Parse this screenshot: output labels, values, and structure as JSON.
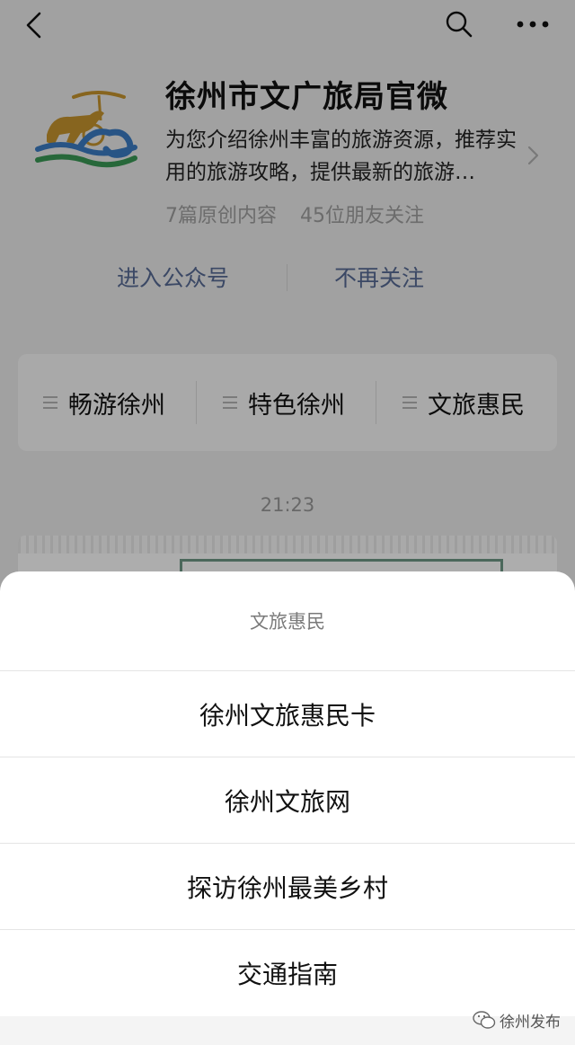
{
  "nav": {
    "back_icon": "back-arrow-icon",
    "search_icon": "search-icon",
    "more_icon": "more-dots-icon"
  },
  "account": {
    "name": "徐州市文广旅局官微",
    "description": "为您介绍徐州丰富的旅游资源，推荐实用的旅游攻略，提供最新的旅游…",
    "original_count": "7篇原创内容",
    "friends_following": "45位朋友关注",
    "enter_label": "进入公众号",
    "unfollow_label": "不再关注",
    "link_color": "#576b95"
  },
  "menu": {
    "items": [
      {
        "label": "畅游徐州"
      },
      {
        "label": "特色徐州"
      },
      {
        "label": "文旅惠民"
      }
    ]
  },
  "chat": {
    "timestamp": "21:23"
  },
  "sheet": {
    "title": "文旅惠民",
    "options": [
      {
        "label": "徐州文旅惠民卡"
      },
      {
        "label": "徐州文旅网"
      },
      {
        "label": "探访徐州最美乡村"
      },
      {
        "label": "交通指南"
      }
    ]
  },
  "watermark": {
    "text": "徐州发布"
  }
}
